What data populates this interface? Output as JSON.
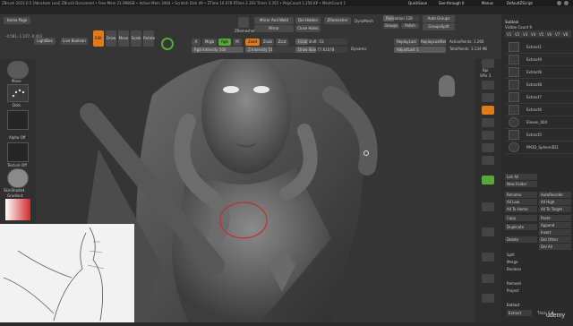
{
  "titlebar": {
    "text": "ZBrush 2022.0.5 [Abraham Leal]   ZBrush Document   • Free Mem 21.998GB • Active Mem 3464 • Scratch Disk 49 • ZTime 10.078 RTime 2.393 Timer 3.355 • PolyCount 1.256 KP • MeshCount 1",
    "quicksave": "QuickSave",
    "see_through": "See-through 0",
    "menus_label": "Menus",
    "script_label": "DefaultZScript"
  },
  "menubar": [
    "Alpha",
    "Brush",
    "Color",
    "Document",
    "Draw",
    "Dynamics",
    "Edit",
    "File",
    "Layer",
    "Light",
    "Macro",
    "Marker",
    "Material",
    "Movie",
    "Picker",
    "Preferences",
    "Render",
    "Stencil",
    "Stroke",
    "Texture",
    "Tool",
    "Transform",
    "Zplugin",
    "Zscript",
    "Help"
  ],
  "toolbar": {
    "home_page": "Home Page",
    "lightbox": "LightBox",
    "live_boolean": "Live Boolean",
    "edit": "Edit",
    "draw": "Draw",
    "move": "Move",
    "scale": "Scale",
    "rotate": "Rotate",
    "a_label": "A",
    "mrgb": "Mrgb",
    "rgb": "Rgb",
    "m_label": "M",
    "zadd": "Zadd",
    "zsub": "Zsub",
    "zcut": "Zcut",
    "rgb_intensity": "Rgb Intensity 100",
    "z_intensity": "Z Intensity 51",
    "focal_shift": "Focal Shift -53",
    "draw_size": "Draw Size 77.61078",
    "dynamic": "Dynamic",
    "mirror_and_weld": "Mirror And Weld",
    "del_hidden": "Del Hidden",
    "mirror": "Mirror",
    "close_holes": "Close Holes",
    "zremesher": "ZRemesher",
    "dynamesh": "DynaMesh",
    "resolution": "Resolution 128",
    "groups": "Groups",
    "polish": "Polish",
    "auto_groups": "Auto Groups",
    "group_visible": "GroupsSplit",
    "replay_last": "ReplayLast",
    "replay_last_rel": "ReplayLastRel",
    "adjust_last": "AdjustLast 1",
    "active_points": "ActivePoints: 1.260",
    "total_points": "TotalPoints: 3.134 Mil"
  },
  "coords": "-0.581,-1.107,-0.403",
  "leftshelf": {
    "brush": "Move",
    "stroke": "Dots",
    "alpha": "Alpha Off",
    "texture": "Texture Off",
    "material": "SkinShade4",
    "gradient": "Gradient",
    "switch_color": "SwitchColor",
    "alternate": "Alternate"
  },
  "rightshelf": [
    "Bpr",
    "SPix 3",
    "Persp",
    "Floor",
    "Local",
    "Frame",
    "Move",
    "Zoom3D",
    "Rotate",
    "Line Fill PolyF",
    "Transp",
    "Solo",
    "Xpose"
  ],
  "rightpanel": {
    "header": "Subtool",
    "visible_count": "Visible Count 9",
    "v_buttons": [
      "V1",
      "V2",
      "V3",
      "V4",
      "V5",
      "V6",
      "V7",
      "V8"
    ],
    "subtools": [
      "Extract1",
      "Extract9",
      "Extract8",
      "Extract8",
      "Extract7",
      "Extract6",
      "Eleven_004",
      "Extract5",
      "PM3D_Sphere3D1"
    ],
    "list_all": "List All",
    "new_folder": "New Folder",
    "rename": "Rename",
    "auto_reorder": "AutoReorder",
    "all_low": "All Low",
    "all_high": "All High",
    "all_to_home": "All To Home",
    "all_to_target": "All To Target",
    "copy": "Copy",
    "paste": "Paste",
    "duplicate": "Duplicate",
    "append": "Append",
    "insert": "Insert",
    "delete": "Delete",
    "del_other": "Del Other",
    "del_all": "Del All",
    "split": "Split",
    "merge": "Merge",
    "boolean": "Boolean",
    "remesh": "Remesh",
    "project": "Project",
    "extract_header": "Extract",
    "extract_btn": "Extract",
    "thick": "Thick 0.0"
  },
  "watermark": "udemy",
  "colors": {
    "accent_orange": "#e07a1a",
    "accent_green": "#57a83a",
    "panel_bg": "#2b2b2b",
    "viewport_bg": "#353535"
  }
}
